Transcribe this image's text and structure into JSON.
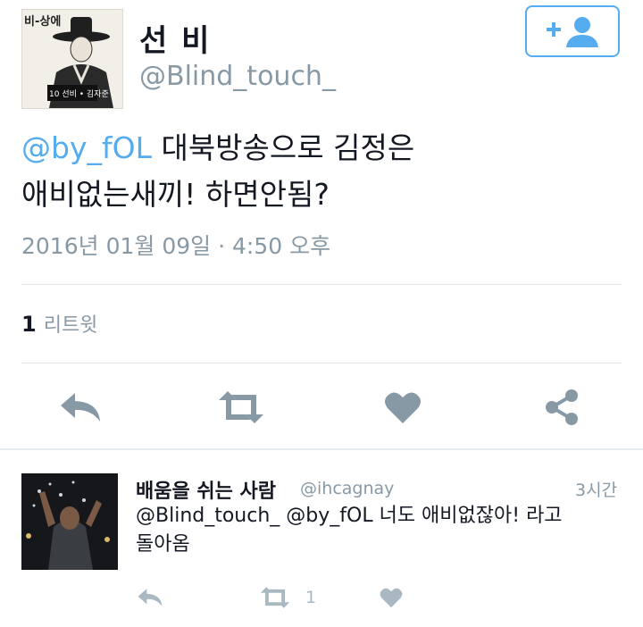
{
  "user": {
    "display_name": "선 비",
    "handle": "@Blind_touch_",
    "avatar_text_top": "비-상에",
    "avatar_text_badge": "10 선비 • 김자준"
  },
  "tweet": {
    "mention": "@by_fOL",
    "text_line1": " 대북방송으로 김정은",
    "text_line2": "애비없는새끼! 하면안됨?",
    "timestamp": "2016년 01월 09일 · 4:50 오후"
  },
  "stats": {
    "retweet_count": "1",
    "retweet_label": "리트윗"
  },
  "icons": {
    "follow": "add-user-icon",
    "reply": "reply-icon",
    "retweet": "retweet-icon",
    "like": "heart-icon",
    "share": "share-icon"
  },
  "colors": {
    "accent": "#55acee",
    "muted": "#8899a6",
    "icon": "#aab8c2"
  },
  "reply": {
    "name": "배움을 쉬는 사람",
    "handle": "@ihcagnay",
    "time": "3시간",
    "text_line1": "@Blind_touch_ @by_fOL 너도 애비없잖아! 라고",
    "text_line2": "돌아옴",
    "retweet_count": "1"
  }
}
